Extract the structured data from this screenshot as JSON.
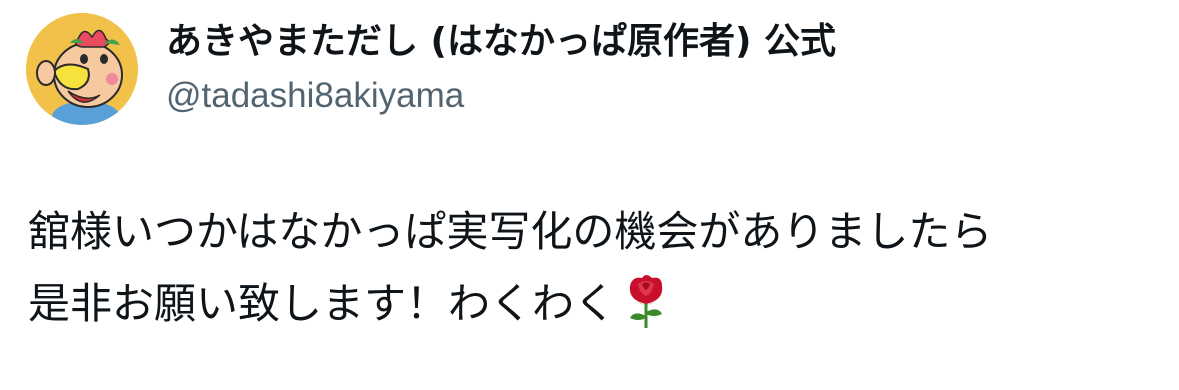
{
  "author": {
    "display_name": "あきやまただし (はなかっぱ原作者) 公式",
    "handle": "@tadashi8akiyama",
    "avatar_icon": "hanakappa-character-avatar"
  },
  "tweet": {
    "line1": "舘様いつかはなかっぱ実写化の機会がありましたら",
    "line2": "是非お願い致します！わくわく",
    "emoji_icon": "rose-emoji"
  },
  "colors": {
    "text": "#0f1419",
    "secondary_text": "#536471",
    "avatar_background": "#f2c14a",
    "rose_red": "#c8102e",
    "rose_leaf": "#3a8a2a"
  }
}
